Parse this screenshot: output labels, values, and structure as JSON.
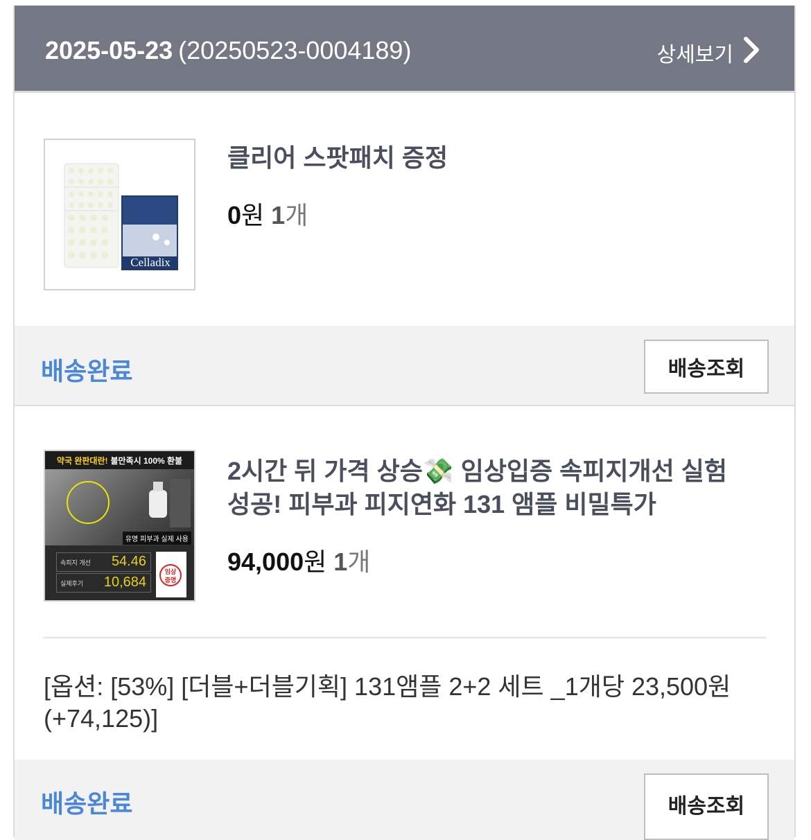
{
  "header": {
    "date": "2025-05-23",
    "order_no": "(20250523-0004189)",
    "detail_label": "상세보기"
  },
  "items": [
    {
      "title": "클리어 스팟패치 증정",
      "price": "0",
      "currency": "원",
      "qty_num": "1",
      "qty_unit": "개",
      "thumb_brand": "Celladix",
      "status": "배송완료",
      "track_label": "배송조회"
    },
    {
      "title_line1": "2시간 뒤 가격 상승💸 임상입증 속피지개선 실험",
      "title_line2": "성공! 피부과 피지연화 131 앰플 비밀특가",
      "price": "94,000",
      "currency": "원",
      "qty_num": "1",
      "qty_unit": "개",
      "option_line1": "[옵션: [53%] [더블+더블기획] 131앰플 2+2 세트 _1개당 23,500원",
      "option_line2": "(+74,125)]",
      "thumb_top_highlight": "약국 완판대란!",
      "thumb_top_text": "불만족시 100% 환불",
      "thumb_caption": "유명 피부과 실제 사용",
      "thumb_stat1_label": "속피지 개선",
      "thumb_stat1_value": "54.46",
      "thumb_stat2_label": "실제후기",
      "thumb_stat2_value": "10,684",
      "thumb_badge": "임상\n증명",
      "status": "배송완료",
      "track_label": "배송조회"
    }
  ],
  "colors": {
    "header_bg": "#737884",
    "status_blue": "#4a86d9"
  }
}
